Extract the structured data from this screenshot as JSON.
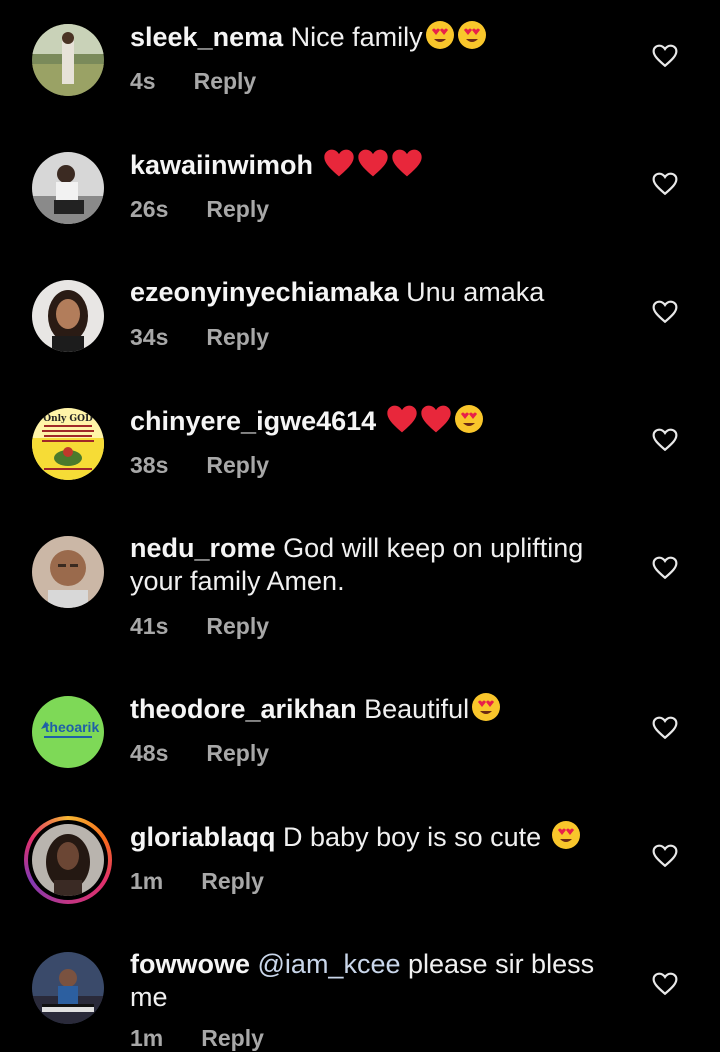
{
  "comments": [
    {
      "username": "sleek_nema",
      "text": "Nice family",
      "emojis": [
        "heart-eyes",
        "heart-eyes"
      ],
      "time": "4s",
      "reply_label": "Reply"
    },
    {
      "username": "kawaiinwimoh",
      "text": "",
      "emojis": [
        "red-heart",
        "red-heart",
        "red-heart"
      ],
      "time": "26s",
      "reply_label": "Reply"
    },
    {
      "username": "ezeonyinyechiamaka",
      "text": "Unu amaka",
      "emojis": [],
      "time": "34s",
      "reply_label": "Reply"
    },
    {
      "username": "chinyere_igwe4614",
      "text": "",
      "emojis": [
        "red-heart",
        "red-heart",
        "heart-eyes"
      ],
      "time": "38s",
      "reply_label": "Reply"
    },
    {
      "username": "nedu_rome",
      "text": "God will keep on uplifting",
      "text2": "your family Amen.",
      "emojis": [],
      "time": "41s",
      "reply_label": "Reply"
    },
    {
      "username": "theodore_arikhan",
      "text": "Beautiful",
      "emojis": [
        "heart-eyes"
      ],
      "time": "48s",
      "reply_label": "Reply",
      "avatar_text": "theoarik"
    },
    {
      "username": "gloriablaqq",
      "text": "D baby boy is so cute",
      "emojis": [
        "heart-eyes"
      ],
      "time": "1m",
      "reply_label": "Reply"
    },
    {
      "username": "fowwowe",
      "mention": "@iam_kcee",
      "text": "please sir bless",
      "text2": "me",
      "emojis": [],
      "time": "1m",
      "reply_label": "Reply"
    }
  ],
  "avatar_badge": {
    "line1": "Only GOD"
  },
  "colors": {
    "background": "#000000",
    "meta": "#a8a8a8",
    "mention": "#c9d6ea",
    "heart": "#e8e8e8"
  }
}
